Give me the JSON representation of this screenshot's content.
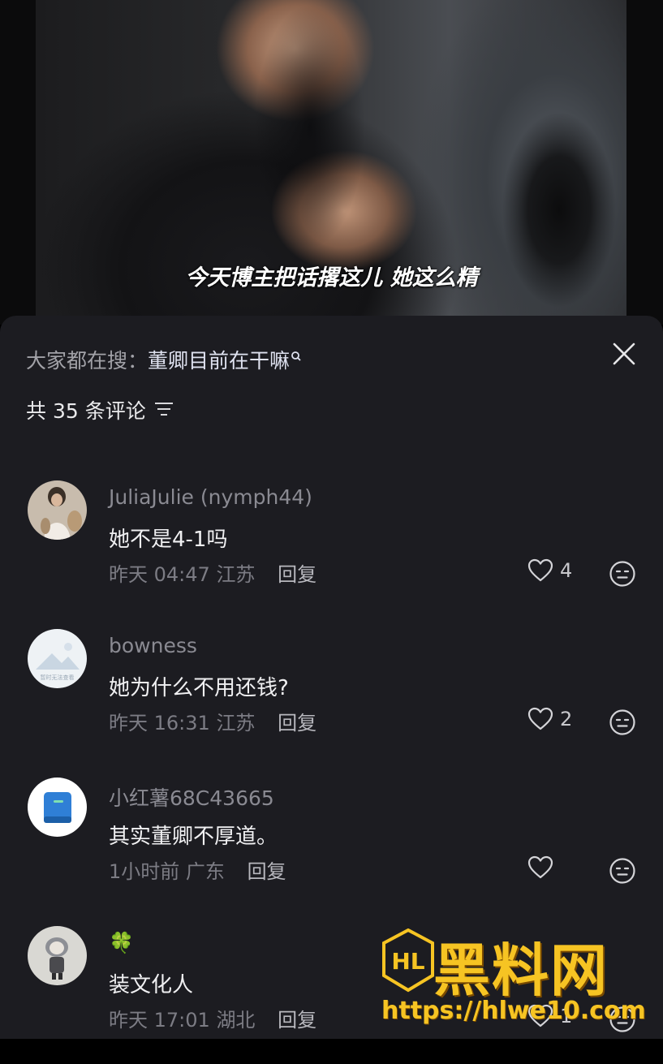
{
  "video": {
    "subtitle": "今天博主把话撂这儿 她这么精"
  },
  "sheet": {
    "search_prefix": "大家都在搜：",
    "search_term": "董卿目前在干嘛",
    "comment_count_label": "共 35 条评论"
  },
  "comments": [
    {
      "username": "JuliaJulie (nymph44)",
      "text": "她不是4-1吗",
      "time": "昨天 04:47",
      "location": "江苏",
      "reply_label": "回复",
      "likes": "4"
    },
    {
      "username": "bowness",
      "avatar_caption": "暂时无法查看",
      "text": "她为什么不用还钱?",
      "time": "昨天 16:31",
      "location": "江苏",
      "reply_label": "回复",
      "likes": "2"
    },
    {
      "username": "小红薯68C43665",
      "text": "其实董卿不厚道。",
      "time": "1小时前",
      "location": "广东",
      "reply_label": "回复",
      "likes": ""
    },
    {
      "username": "🍀",
      "text": "装文化人",
      "time": "昨天 17:01",
      "location": "湖北",
      "reply_label": "回复",
      "likes": "1"
    }
  ],
  "watermark": {
    "brand": "黑料网",
    "url": "https://hlwe10.com",
    "logo_letters": "HL"
  },
  "icons": {
    "close": "close-icon",
    "sort": "sort-icon",
    "like": "heart-icon",
    "react": "emoji-icon",
    "search": "search-icon"
  },
  "colors": {
    "sheet_bg": "#1c1c21",
    "text_primary": "#f0f0f2",
    "text_secondary": "#7c7c84",
    "watermark": "#f6c423"
  }
}
